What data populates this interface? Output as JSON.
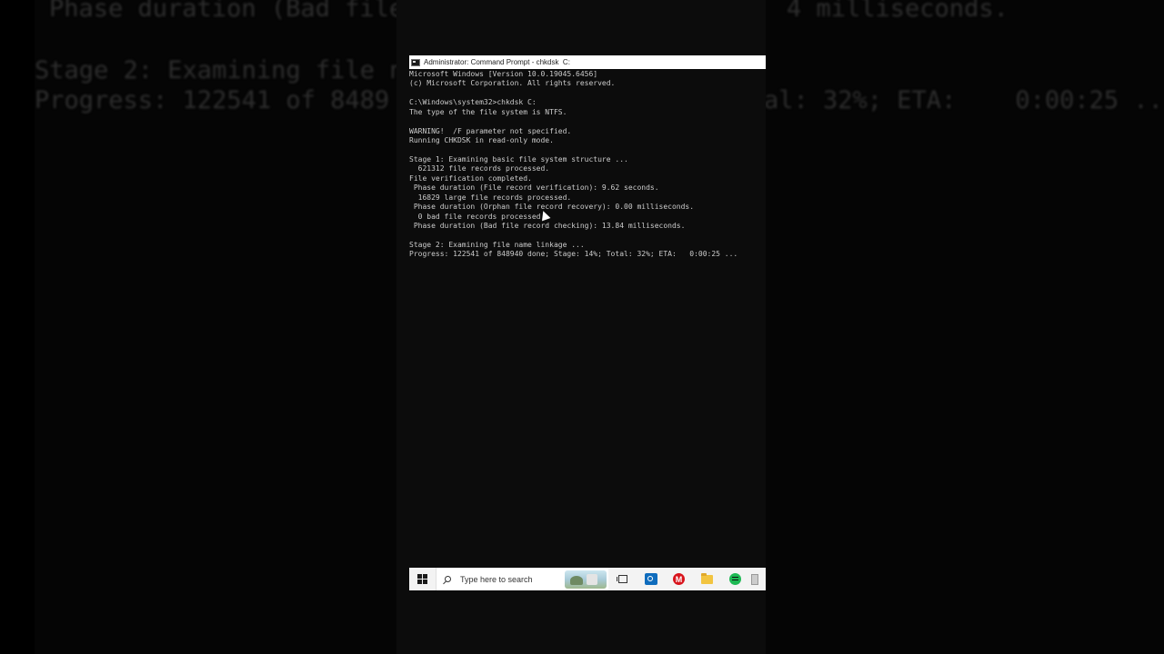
{
  "background": {
    "line1_left": "Phase duration (Bad file",
    "line1_right": "4 milliseconds.",
    "line2": "Stage 2: Examining file n",
    "line3_left": "Progress: 122541 of 8489",
    "line3_right": "al: 32%; ETA:    0:00:25 ..."
  },
  "window": {
    "title": "Administrator: Command Prompt - chkdsk  C:",
    "lines": [
      "Microsoft Windows [Version 10.0.19045.6456]",
      "(c) Microsoft Corporation. All rights reserved.",
      "",
      "C:\\Windows\\system32>chkdsk C:",
      "The type of the file system is NTFS.",
      "",
      "WARNING!  /F parameter not specified.",
      "Running CHKDSK in read-only mode.",
      "",
      "Stage 1: Examining basic file system structure ...",
      "  621312 file records processed.",
      "File verification completed.",
      " Phase duration (File record verification): 9.62 seconds.",
      "  16829 large file records processed.",
      " Phase duration (Orphan file record recovery): 0.00 milliseconds.",
      "  0 bad file records processed.",
      " Phase duration (Bad file record checking): 13.84 milliseconds.",
      "",
      "Stage 2: Examining file name linkage ...",
      "Progress: 122541 of 848940 done; Stage: 14%; Total: 32%; ETA:   0:00:25 ..."
    ]
  },
  "taskbar": {
    "search_placeholder": "Type here to search",
    "icons": [
      "windows-start-icon",
      "search-icon",
      "task-view-icon",
      "outlook-icon",
      "mcafee-icon",
      "file-explorer-icon",
      "spotify-icon",
      "app-icon"
    ],
    "mcafee_letter": "M"
  }
}
